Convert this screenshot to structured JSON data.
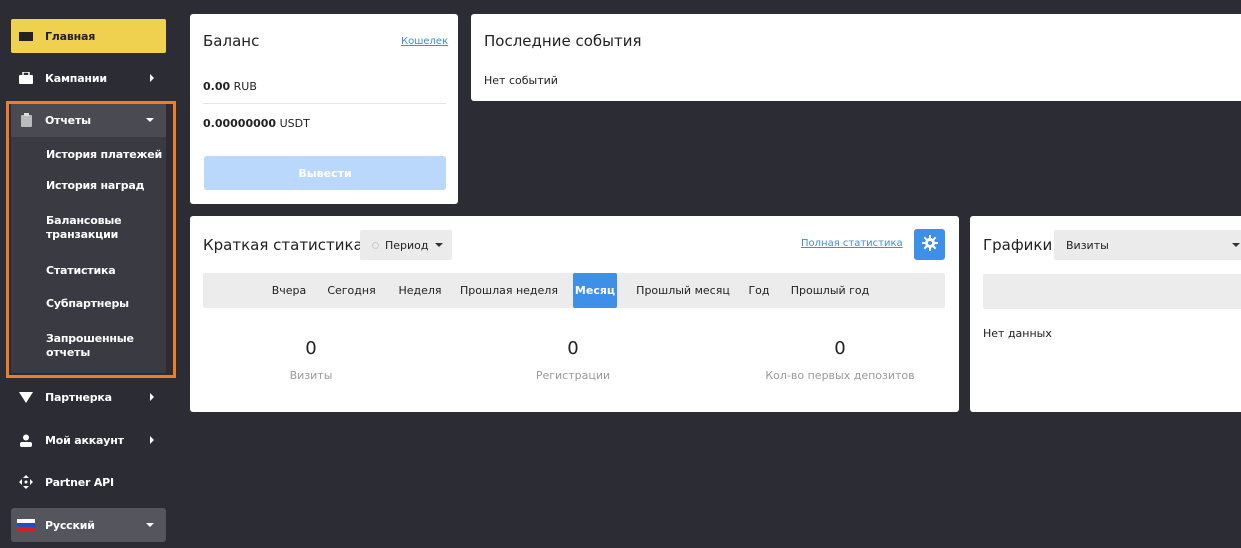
{
  "sidebar": {
    "home": "Главная",
    "campaigns": "Кампании",
    "reports": "Отчеты",
    "reports_sub": [
      "История платежей",
      "История наград",
      "Балансовые транзакции",
      "Статистика",
      "Субпартнеры",
      "Запрошенные отчеты"
    ],
    "partner": "Партнерка",
    "account": "Мой аккаунт",
    "api": "Partner API",
    "language": "Русский"
  },
  "balance": {
    "title": "Баланс",
    "wallet_link": "Кошелек",
    "rub_amount": "0.00",
    "rub_currency": "RUB",
    "usdt_amount": "0.00000000",
    "usdt_currency": "USDT",
    "withdraw": "Вывести"
  },
  "events": {
    "title": "Последние события",
    "empty": "Нет событий"
  },
  "stats": {
    "title": "Краткая статистика",
    "period": "Период",
    "full_link": "Полная статистика",
    "tabs": [
      "Вчера",
      "Сегодня",
      "Неделя",
      "Прошлая неделя",
      "Месяц",
      "Прошлый месяц",
      "Год",
      "Прошлый год"
    ],
    "active_tab": "Месяц",
    "metrics": [
      {
        "value": "0",
        "label": "Визиты"
      },
      {
        "value": "0",
        "label": "Регистрации"
      },
      {
        "value": "0",
        "label": "Кол-во первых депозитов"
      }
    ]
  },
  "charts": {
    "title": "Графики",
    "selected": "Визиты",
    "empty": "Нет данных"
  },
  "colors": {
    "accent": "#3d8fe8",
    "home_active": "#f0d04f",
    "highlight": "#ee7d28",
    "sidebar_bg": "#2c2c34"
  }
}
